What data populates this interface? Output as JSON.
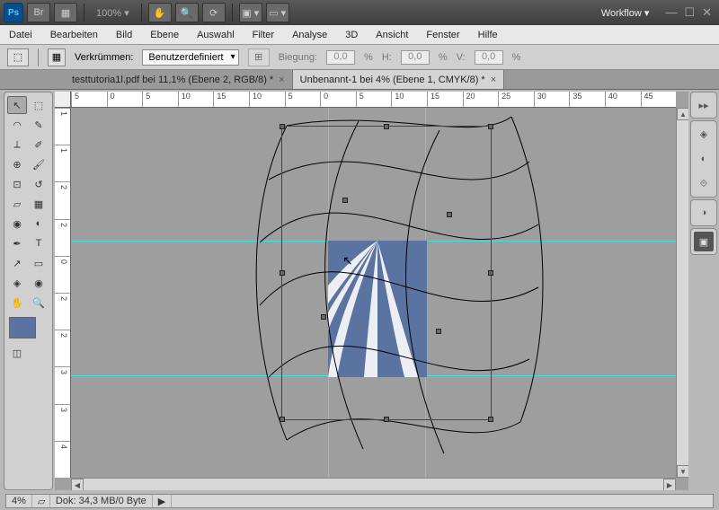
{
  "appbar": {
    "zoom": "100%",
    "workspace_label": "Workflow ▾"
  },
  "menu": [
    "Datei",
    "Bearbeiten",
    "Bild",
    "Ebene",
    "Auswahl",
    "Filter",
    "Analyse",
    "3D",
    "Ansicht",
    "Fenster",
    "Hilfe"
  ],
  "options": {
    "label": "Verkrümmen:",
    "warp_preset": "Benutzerdefiniert",
    "bend_label": "Biegung:",
    "bend_value": "0,0",
    "h_label": "H:",
    "h_value": "0,0",
    "v_label": "V:",
    "v_value": "0,0",
    "pct": "%"
  },
  "tabs": [
    {
      "title": "testtutoria1l.pdf bei 11,1% (Ebene 2, RGB/8) *"
    },
    {
      "title": "Unbenannt-1 bei 4% (Ebene 1, CMYK/8) *"
    }
  ],
  "ruler_h": [
    "5",
    "0",
    "5",
    "10",
    "15",
    "10",
    "5",
    "0",
    "5",
    "10",
    "15",
    "20",
    "25",
    "30",
    "35",
    "40",
    "45"
  ],
  "ruler_v": [
    "1",
    "1",
    "2",
    "2",
    "0",
    "2",
    "2",
    "3",
    "3",
    "4"
  ],
  "status": {
    "zoom": "4%",
    "doc": "Dok: 34,3 MB/0 Byte"
  },
  "colors": {
    "fg": "#5a73a0",
    "bg": "#ffffff"
  }
}
